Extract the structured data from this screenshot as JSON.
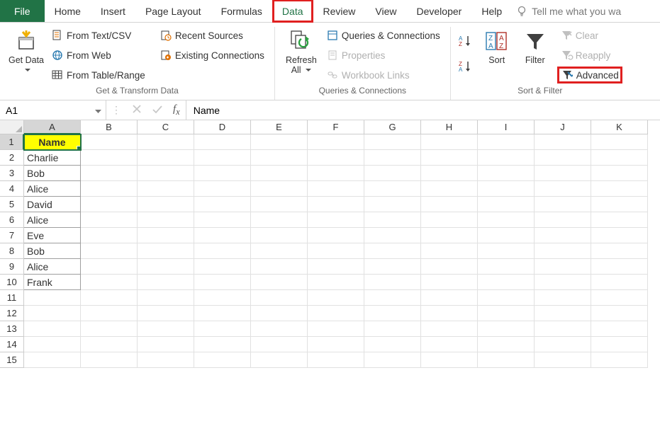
{
  "tabs": {
    "file": "File",
    "items": [
      "Home",
      "Insert",
      "Page Layout",
      "Formulas",
      "Data",
      "Review",
      "View",
      "Developer",
      "Help"
    ],
    "active": "Data",
    "tellme": "Tell me what you wa"
  },
  "ribbon": {
    "group1": {
      "label": "Get & Transform Data",
      "getdata": "Get Data",
      "fromtext": "From Text/CSV",
      "fromweb": "From Web",
      "fromtable": "From Table/Range",
      "recent": "Recent Sources",
      "existing": "Existing Connections"
    },
    "group2": {
      "label": "Queries & Connections",
      "refresh": "Refresh All",
      "queries": "Queries & Connections",
      "properties": "Properties",
      "workbooklinks": "Workbook Links"
    },
    "group3": {
      "label": "Sort & Filter",
      "sort": "Sort",
      "filter": "Filter",
      "clear": "Clear",
      "reapply": "Reapply",
      "advanced": "Advanced"
    }
  },
  "formulabar": {
    "namebox": "A1",
    "formula": "Name"
  },
  "columns": [
    "A",
    "B",
    "C",
    "D",
    "E",
    "F",
    "G",
    "H",
    "I",
    "J",
    "K"
  ],
  "selected_col": "A",
  "selected_row": 1,
  "data": {
    "1": "Name",
    "2": "Charlie",
    "3": "Bob",
    "4": "Alice",
    "5": "David",
    "6": "Alice",
    "7": "Eve",
    "8": "Bob",
    "9": "Alice",
    "10": "Frank"
  },
  "total_rows": 15
}
